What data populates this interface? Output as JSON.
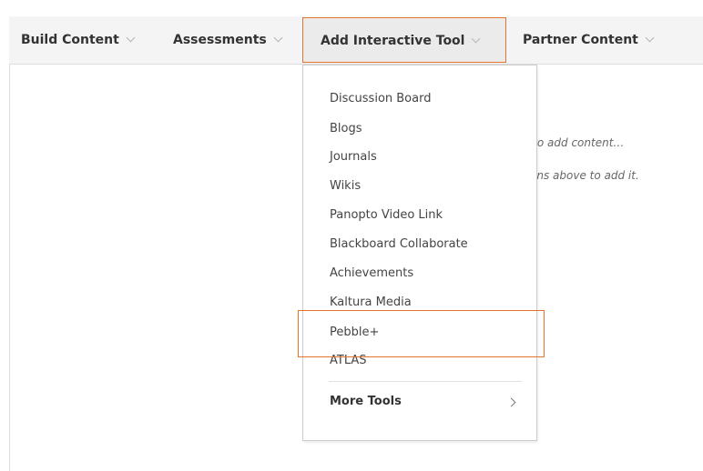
{
  "toolbar": {
    "build_content": "Build Content",
    "assessments": "Assessments",
    "add_interactive_tool": "Add Interactive Tool",
    "partner_content": "Partner Content"
  },
  "content": {
    "hint_line1": "e to add content…",
    "hint_line2": "tions above to add it."
  },
  "dropdown": {
    "items": [
      "Discussion Board",
      "Blogs",
      "Journals",
      "Wikis",
      "Panopto Video Link",
      "Blackboard Collaborate",
      "Achievements",
      "Kaltura Media",
      "Pebble+",
      "ATLAS"
    ],
    "more_tools": "More Tools"
  },
  "colors": {
    "accent_orange": "#e2762f",
    "toolbar_bg": "#f4f4f4",
    "text_dark": "#333333"
  }
}
